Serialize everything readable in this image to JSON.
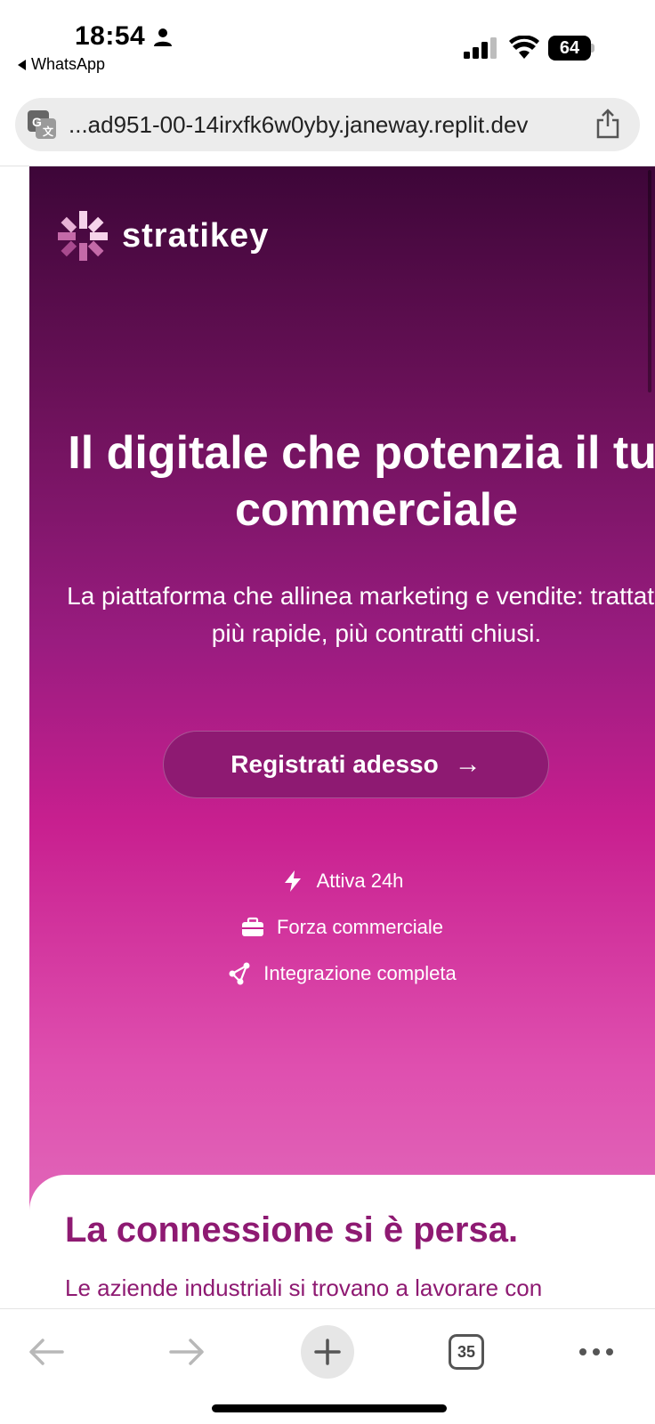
{
  "status_bar": {
    "time": "18:54",
    "back_app": "WhatsApp",
    "battery_level": "64"
  },
  "browser": {
    "url": "...ad951-00-14irxfk6w0yby.janeway.replit.dev",
    "open_tabs_count": "35"
  },
  "hero": {
    "logo_text": "stratikey",
    "headline": "Il digitale che potenzia il tuo commerciale",
    "subheadline": "La piattaforma che allinea marketing e vendite: trattative più rapide, più contratti chiusi.",
    "cta_label": "Registrati adesso",
    "cta_arrow": "→",
    "features": [
      {
        "icon": "bolt-icon",
        "label": "Attiva 24h"
      },
      {
        "icon": "briefcase-icon",
        "label": "Forza commerciale"
      },
      {
        "icon": "network-icon",
        "label": "Integrazione completa"
      }
    ]
  },
  "section": {
    "title": "La connessione si è persa.",
    "body_preview": "Le aziende industriali si trovano a lavorare con"
  },
  "colors": {
    "brand_dark": "#3d0638",
    "brand_mid": "#9a1c80",
    "brand_accent": "#c81f8f",
    "cta_bg": "#8e1a72"
  }
}
